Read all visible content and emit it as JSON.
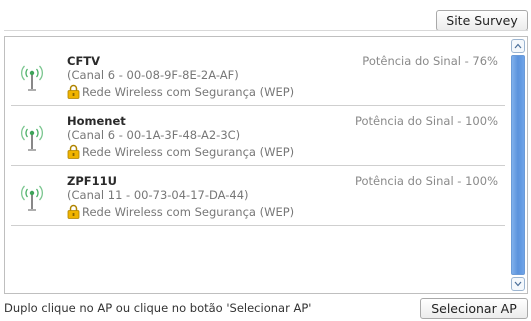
{
  "toolbar": {
    "site_survey_label": "Site Survey"
  },
  "networks": [
    {
      "ssid": "CFTV",
      "channel_info": "(Canal 6 - 00-08-9F-8E-2A-AF)",
      "security": "Rede Wireless com Segurança (WEP)",
      "signal": "Potência do Sinal - 76%",
      "icon": "wifi-antenna-icon"
    },
    {
      "ssid": "Homenet",
      "channel_info": "(Canal 6 - 00-1A-3F-48-A2-3C)",
      "security": "Rede Wireless com Segurança (WEP)",
      "signal": "Potência do Sinal - 100%",
      "icon": "wifi-antenna-icon"
    },
    {
      "ssid": "ZPF11U",
      "channel_info": "(Canal 11 - 00-73-04-17-DA-44)",
      "security": "Rede Wireless com Segurança (WEP)",
      "signal": "Potência do Sinal - 100%",
      "icon": "wifi-antenna-icon"
    }
  ],
  "footer": {
    "hint": "Duplo clique no AP ou clique no botão 'Selecionar AP'",
    "select_ap_label": "Selecionar AP"
  },
  "colors": {
    "accent": "#5a92dc",
    "lock": "#f0b400",
    "antenna": "#3fa35a"
  }
}
